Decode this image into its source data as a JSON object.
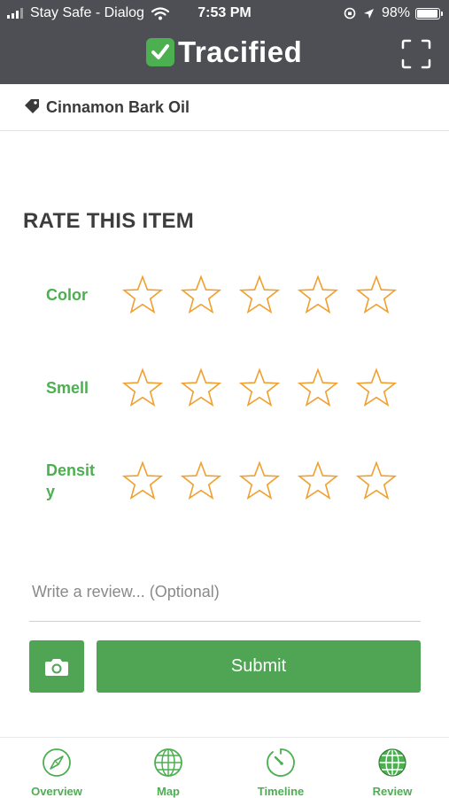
{
  "status_bar": {
    "carrier": "Stay Safe - Dialog",
    "time": "7:53 PM",
    "battery": "98%",
    "battery_level": 0.98
  },
  "header": {
    "app_name": "Tracified",
    "logo_color": "#4caf50",
    "background": "#4d4f54",
    "scan_icon": "scan-frame-icon"
  },
  "product": {
    "name": "Cinnamon Bark Oil",
    "icon": "tag-icon"
  },
  "rating": {
    "title": "RATE THIS ITEM",
    "star_color": "#f0a030",
    "max_stars": 5,
    "criteria": [
      {
        "label": "Color",
        "value": 0
      },
      {
        "label": "Smell",
        "value": 0
      },
      {
        "label": "Densit\ny",
        "value": 0
      }
    ]
  },
  "review": {
    "placeholder": "Write a review... (Optional)",
    "value": ""
  },
  "actions": {
    "camera_icon": "camera-icon",
    "submit_label": "Submit",
    "button_color": "#4fa554"
  },
  "tabs": [
    {
      "label": "Overview",
      "icon": "compass-icon"
    },
    {
      "label": "Map",
      "icon": "globe-icon"
    },
    {
      "label": "Timeline",
      "icon": "timer-icon"
    },
    {
      "label": "Review",
      "icon": "globe-filled-icon",
      "active": true
    }
  ]
}
